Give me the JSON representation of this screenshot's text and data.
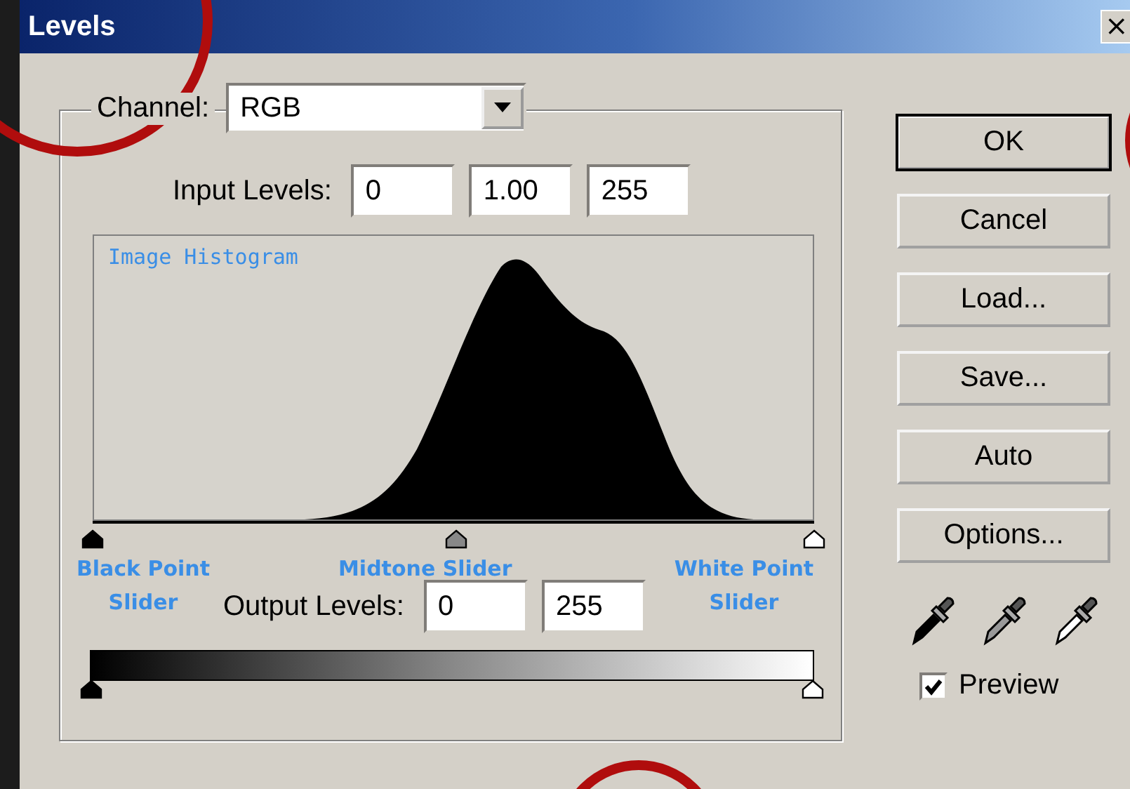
{
  "window": {
    "title": "Levels",
    "close": "×"
  },
  "channel": {
    "label": "Channel:",
    "value": "RGB"
  },
  "input_levels": {
    "label": "Input Levels:",
    "values": [
      "0",
      "1.00",
      "255"
    ]
  },
  "histogram": {
    "title": "Image Histogram"
  },
  "input_sliders": [
    {
      "kind": "black",
      "level": 0
    },
    {
      "kind": "midtone",
      "level": 0.504
    },
    {
      "kind": "white",
      "level": 1
    }
  ],
  "annotations": [
    "Black Point\nSlider",
    "Midtone Slider",
    "White Point\nSlider"
  ],
  "output_levels": {
    "label": "Output Levels:",
    "values": [
      "0",
      "255"
    ]
  },
  "output_sliders": [
    {
      "kind": "black",
      "level": 0
    },
    {
      "kind": "white",
      "level": 1
    }
  ],
  "buttons": [
    {
      "label": "OK",
      "default": true
    },
    {
      "label": "Cancel",
      "default": false
    },
    {
      "label": "Load...",
      "default": false
    },
    {
      "label": "Save...",
      "default": false
    },
    {
      "label": "Auto",
      "default": false
    },
    {
      "label": "Options...",
      "default": false
    }
  ],
  "preview": {
    "label": "Preview",
    "checked": true
  }
}
